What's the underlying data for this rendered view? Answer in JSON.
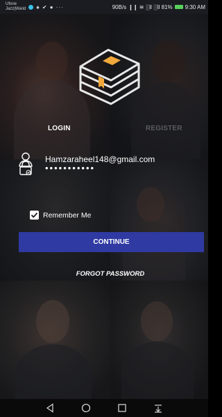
{
  "status_bar": {
    "carrier_line1": "Ufone",
    "carrier_line2": "Jazz|Warid",
    "left_icons": "♠ ✔ ● ···",
    "speed": "90B/s",
    "signal": "❙❙ ≋ ░ll ░ll 81%",
    "time": "9:30 AM"
  },
  "tabs": {
    "login": "LOGIN",
    "register": "REGISTER"
  },
  "form": {
    "email_value": "Hamzaraheel148@gmail.com",
    "password_value": "•••••••••••",
    "remember_label": "Remember Me",
    "remember_checked": true,
    "continue_label": "CONTINUE",
    "forgot_label": "FORGOT PASSWORD"
  },
  "icons": {
    "logo": "books-logo-icon",
    "email": "person-icon",
    "password": "lock-icon",
    "checkbox": "checkmark-icon",
    "back": "back-triangle-icon",
    "home": "home-circle-icon",
    "recents": "recents-square-icon",
    "notifications": "pull-down-icon"
  },
  "colors": {
    "button": "#2f3aa2",
    "logo_accent": "#f2a93b",
    "inactive_tab": "#5a5b60",
    "battery": "#58d05a"
  }
}
